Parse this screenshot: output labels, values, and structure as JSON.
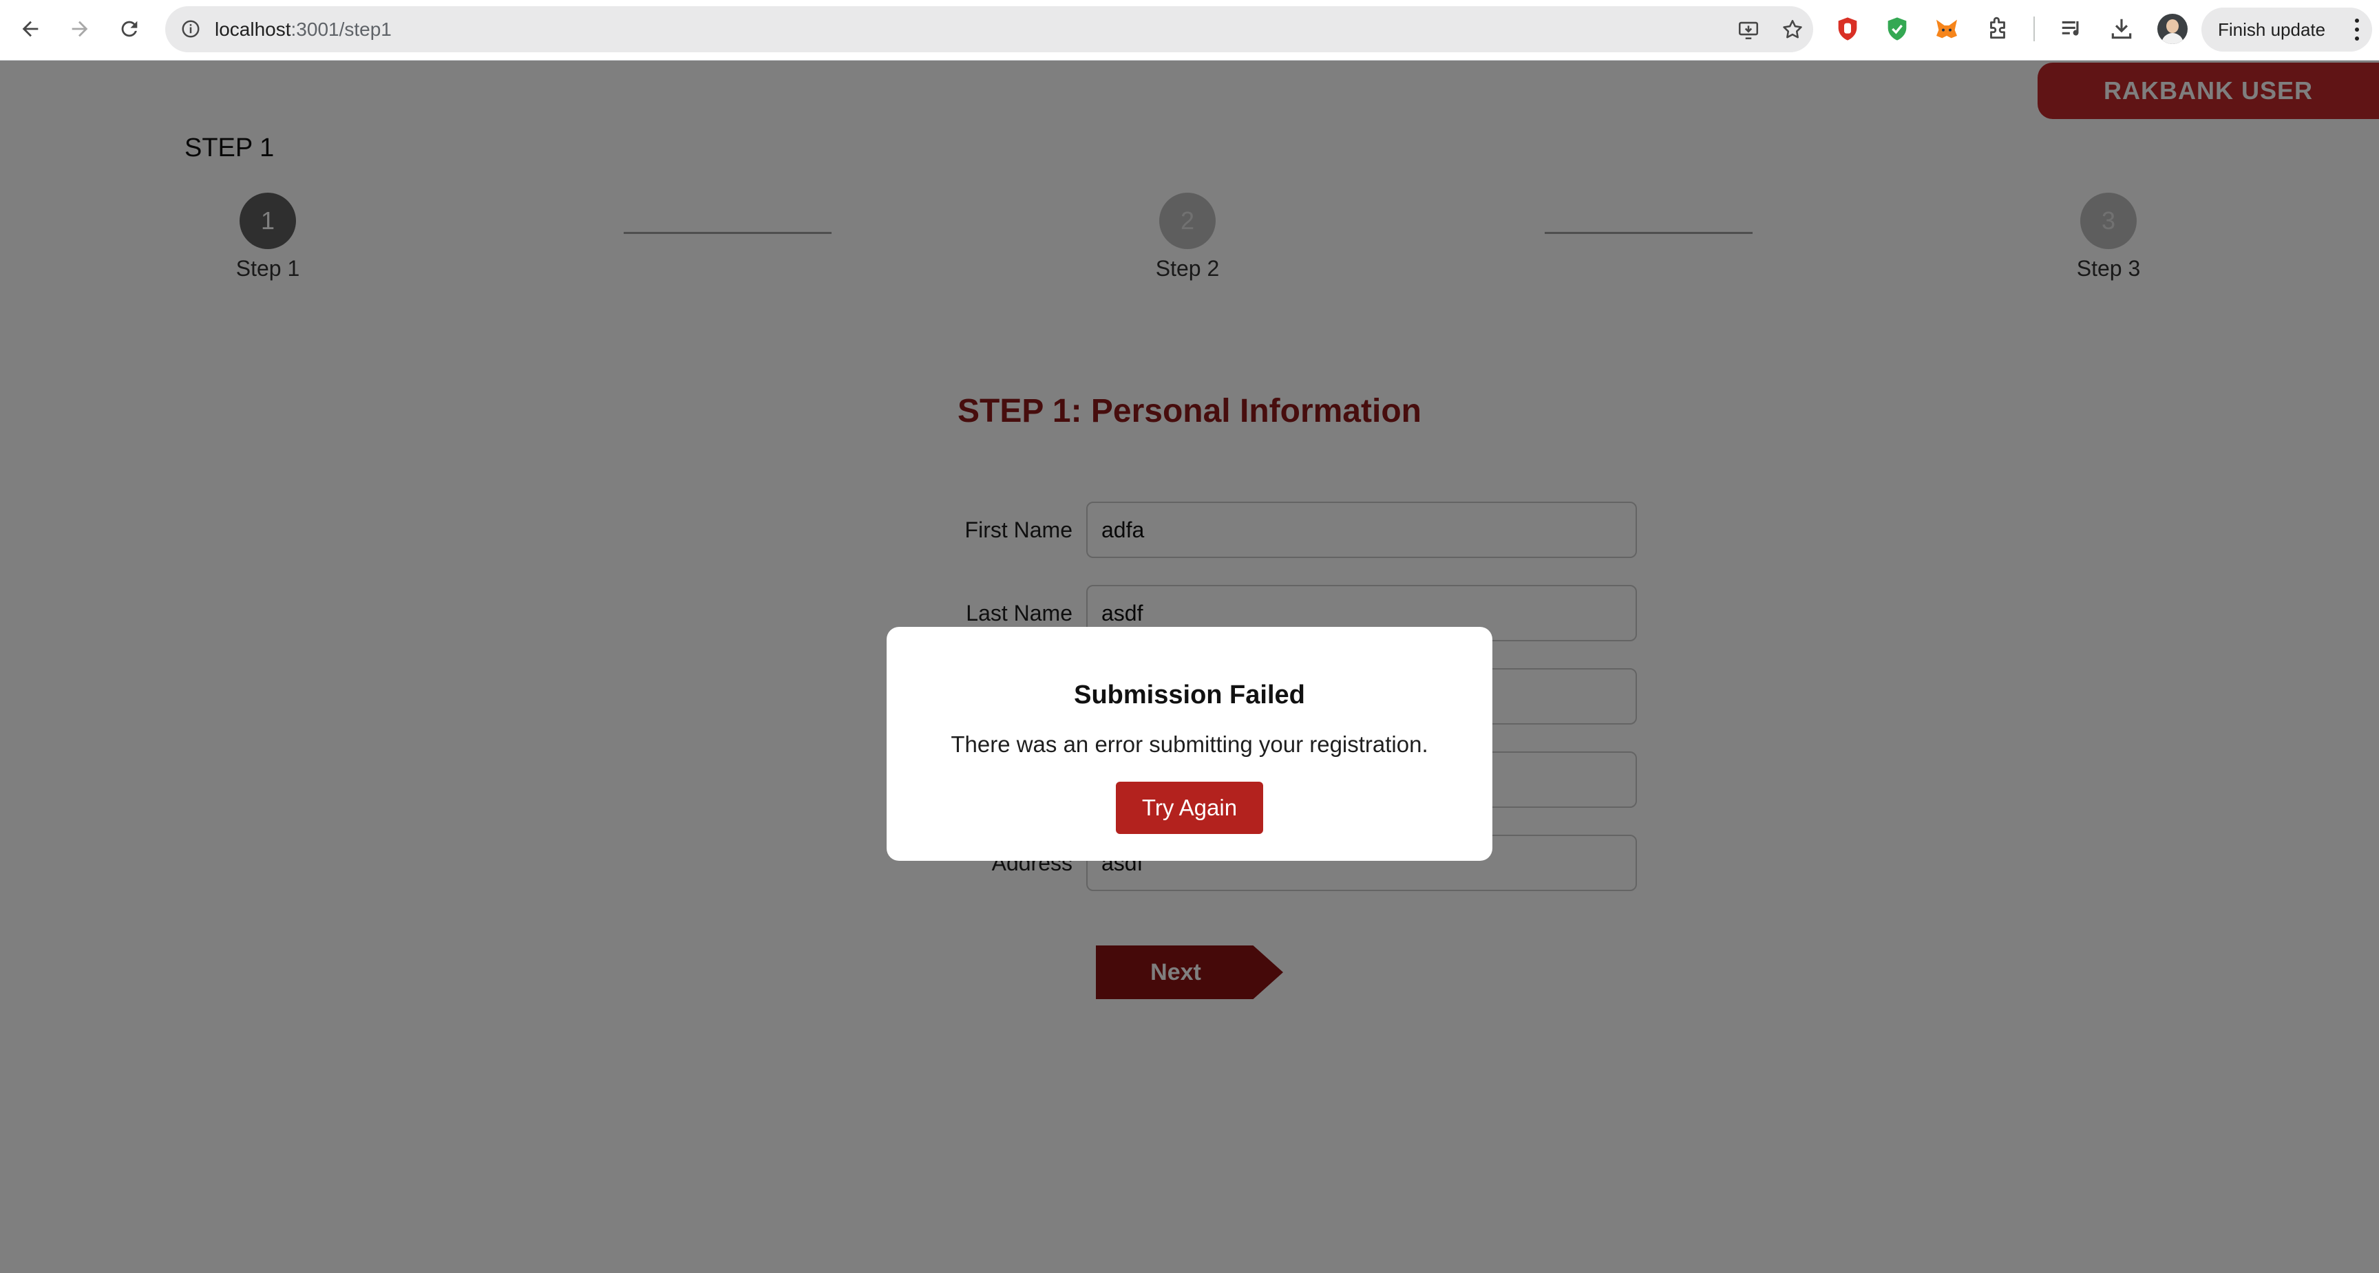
{
  "browser": {
    "url_host": "localhost",
    "url_path": ":3001/step1",
    "finish_update_label": "Finish update"
  },
  "header": {
    "user_badge": "RAKBANK USER"
  },
  "stepper": {
    "heading": "STEP 1",
    "steps": [
      {
        "number": "1",
        "label": "Step 1",
        "state": "active"
      },
      {
        "number": "2",
        "label": "Step 2",
        "state": "pending"
      },
      {
        "number": "3",
        "label": "Step 3",
        "state": "pending"
      }
    ]
  },
  "form": {
    "title": "STEP 1: Personal Information",
    "fields": [
      {
        "label": "First Name",
        "value": "adfa"
      },
      {
        "label": "Last Name",
        "value": "asdf"
      },
      {
        "label": "",
        "value": ""
      },
      {
        "label": "",
        "value": ""
      },
      {
        "label": "Address",
        "value": "asdf"
      }
    ],
    "next_label": "Next"
  },
  "modal": {
    "title": "Submission Failed",
    "message": "There was an error submitting your registration.",
    "button_label": "Try Again"
  },
  "colors": {
    "brand_red": "#c0282a",
    "title_red": "#8e1b1b",
    "button_red": "#b3221e",
    "next_red": "#8a1212"
  }
}
